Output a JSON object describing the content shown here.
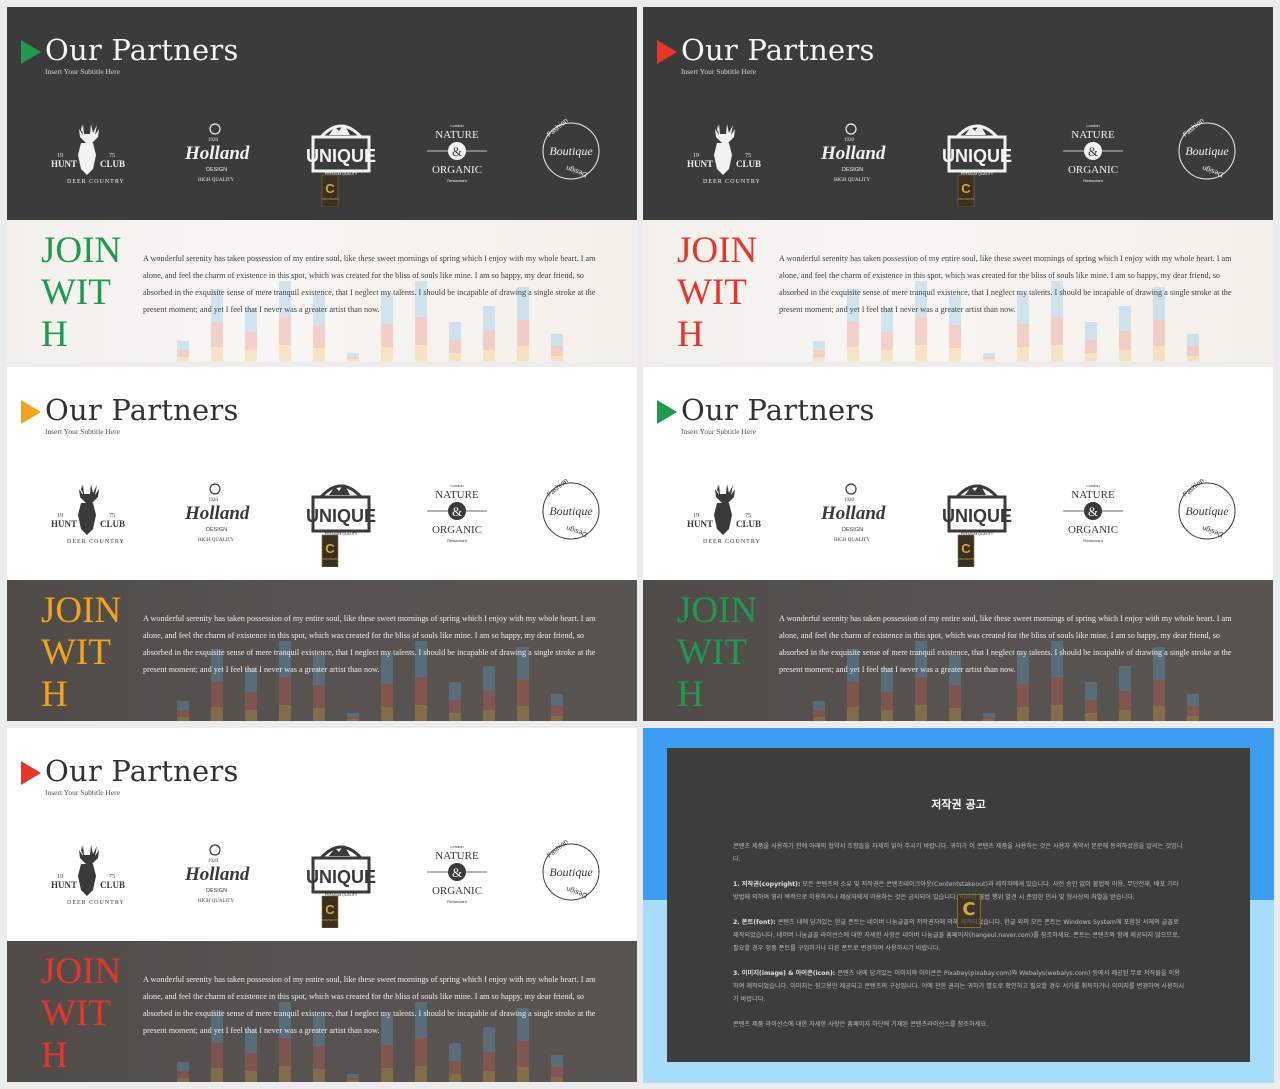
{
  "slides": [
    {
      "theme": "dark",
      "accent": "#1f9a4e",
      "title": "Our Partners",
      "subtitle": "Insert Your Subtitle Here",
      "join_lines": [
        "JOIN",
        "WIT",
        "H"
      ],
      "bottom_theme": "light",
      "body": "A wonderful serenity has taken possession of my entire soul, like these sweet mornings of spring which I enjoy with my whole heart. I am alone, and feel the charm of existence in this spot, which was created for the bliss of souls like mine. I am so happy, my dear friend, so absorbed in the exquisite sense of mere tranquil existence, that I neglect my talents. I should be incapable of drawing a single stroke at the present moment; and yet I feel that I never was a greater artist than now."
    },
    {
      "theme": "dark",
      "accent": "#e8352c",
      "title": "Our Partners",
      "subtitle": "Insert Your Subtitle Here",
      "join_lines": [
        "JOIN",
        "WIT",
        "H"
      ],
      "bottom_theme": "light",
      "body": "A wonderful serenity has taken possession of my entire soul, like these sweet mornings of spring which I enjoy with my whole heart. I am alone, and feel the charm of existence in this spot, which was created for the bliss of souls like mine. I am so happy, my dear friend, so absorbed in the exquisite sense of mere tranquil existence, that I neglect my talents. I should be incapable of drawing a single stroke at the present moment; and yet I feel that I never was a greater artist than now."
    },
    {
      "theme": "light",
      "accent": "#f4a21e",
      "title": "Our Partners",
      "subtitle": "Insert Your Subtitle Here",
      "join_lines": [
        "JOIN",
        "WIT",
        "H"
      ],
      "bottom_theme": "dark",
      "body": "A wonderful serenity has taken possession of my entire soul, like these sweet mornings of spring which I enjoy with my whole heart. I am alone, and feel the charm of existence in this spot, which was created for the bliss of souls like mine. I am so happy, my dear friend, so absorbed in the exquisite sense of mere tranquil existence, that I neglect my talents. I should be incapable of drawing a single stroke at the present moment; and yet I feel that I never was a greater artist than now."
    },
    {
      "theme": "light",
      "accent": "#1f9a4e",
      "title": "Our Partners",
      "subtitle": "Insert Your Subtitle Here",
      "join_lines": [
        "JOIN",
        "WIT",
        "H"
      ],
      "bottom_theme": "dark",
      "body": "A wonderful serenity has taken possession of my entire soul, like these sweet mornings of spring which I enjoy with my whole heart. I am alone, and feel the charm of existence in this spot, which was created for the bliss of souls like mine. I am so happy, my dear friend, so absorbed in the exquisite sense of mere tranquil existence, that I neglect my talents. I should be incapable of drawing a single stroke at the present moment; and yet I feel that I never was a greater artist than now."
    },
    {
      "theme": "light",
      "accent": "#e8352c",
      "title": "Our Partners",
      "subtitle": "Insert Your Subtitle Here",
      "join_lines": [
        "JOIN",
        "WIT",
        "H"
      ],
      "bottom_theme": "dark",
      "body": "A wonderful serenity has taken possession of my entire soul, like these sweet mornings of spring which I enjoy with my whole heart. I am alone, and feel the charm of existence in this spot, which was created for the bliss of souls like mine. I am so happy, my dear friend, so absorbed in the exquisite sense of mere tranquil existence, that I neglect my talents. I should be incapable of drawing a single stroke at the present moment; and yet I feel that I never was a greater artist than now."
    }
  ],
  "logos": {
    "hunt_club": {
      "year_left": "19",
      "year_right": "75",
      "left": "HUNT",
      "right": "CLUB",
      "arc": "DEER COUNTRY"
    },
    "holland": {
      "year": "1920",
      "name": "Holland",
      "line1": "DESIGN",
      "line2": "HIGH QUALITY"
    },
    "unique": {
      "name": "UNIQUE",
      "tagline": "PREMIUM QUALITY",
      "badge_letter": "C",
      "badge_text": "CONTENTS"
    },
    "nature": {
      "top": "London",
      "line1": "NATURE",
      "amp": "&",
      "line2": "ORGANIC",
      "bottom": "Restaurant"
    },
    "boutique": {
      "top": "Fashion",
      "name": "Boutique",
      "bottom": "Design"
    }
  },
  "copyright": {
    "title": "저작권 공고",
    "intro": "콘텐츠 제품을 사용하기 전에 아래의 협약서 조항들을 자세히 읽어 주시기 바랍니다. 귀하가 이 콘텐츠 제품을 사용하는 것은 사용자 계약서 본문에 동의하셨음을 알리는 것입니다.",
    "items": [
      {
        "label": "1. 저작권(copyright):",
        "text": "모든 콘텐츠의 소유 및 저작권은 콘텐츠테이크아웃(Contentstakeout)과 제작자에게 있습니다. 사전 승인 없이 불법적 이용, 무단전재, 배포 기타 방법에 의하여 영리 목적으로 이용하거나 제삼자에게 이용하는 것은 금지되어 있습니다. 이러한 불법 행위 발견 시 준엄한 민사 및 형사상의 처벌을 받습니다."
      },
      {
        "label": "2. 폰트(font):",
        "text": "콘텐츠 내에 담겨있는 한글 폰트는 네이버 나눔글꼴의 저작권자에 의해 제작되었습니다. 한글 외의 모든 폰트는 Windows System에 포함된 서체의 글꼴로 제작되었습니다. 네이버 나눔글꼴 라이선스에 대한 자세한 사항은 네이버 나눔글꼴 홈페이지(hangeul.naver.com)를 참조하세요. 폰트는 콘텐츠와 함께 제공되지 않으므로, 필요할 경우 정품 폰트를 구입하거나 다른 폰트로 변경하여 사용하시기 바랍니다."
      },
      {
        "label": "3. 이미지(image) & 아이콘(icon):",
        "text": "콘텐츠 내에 담겨있는 이미지와 아이콘은 Pixabay(pixabay.com)와 Webalys(webalys.com) 등에서 제공된 무료 저작물을 이용하여 제작되었습니다. 이미지는 참고용만 제공되고 콘텐츠의 구성입니다. 이에 관한 권리는 귀하가 별도로 확인하고 필요할 경우 서기를 취득하거나 이미지를 변경하여 사용하시기 바랍니다."
      }
    ],
    "footer": "콘텐츠 제품 라이선스에 대한 자세한 사항은 홈페이지 하단에 기재된 콘텐츠라이선스를 참조하세요.",
    "watermark": "C"
  },
  "bar_chart_bg": [
    20,
    70,
    52,
    78,
    64,
    8,
    66,
    78,
    38,
    54,
    72,
    26
  ],
  "colors": {
    "copy_band": "#3d9df2",
    "copy_bg": "#a8dcfb",
    "panel": "#3d3d3d"
  }
}
